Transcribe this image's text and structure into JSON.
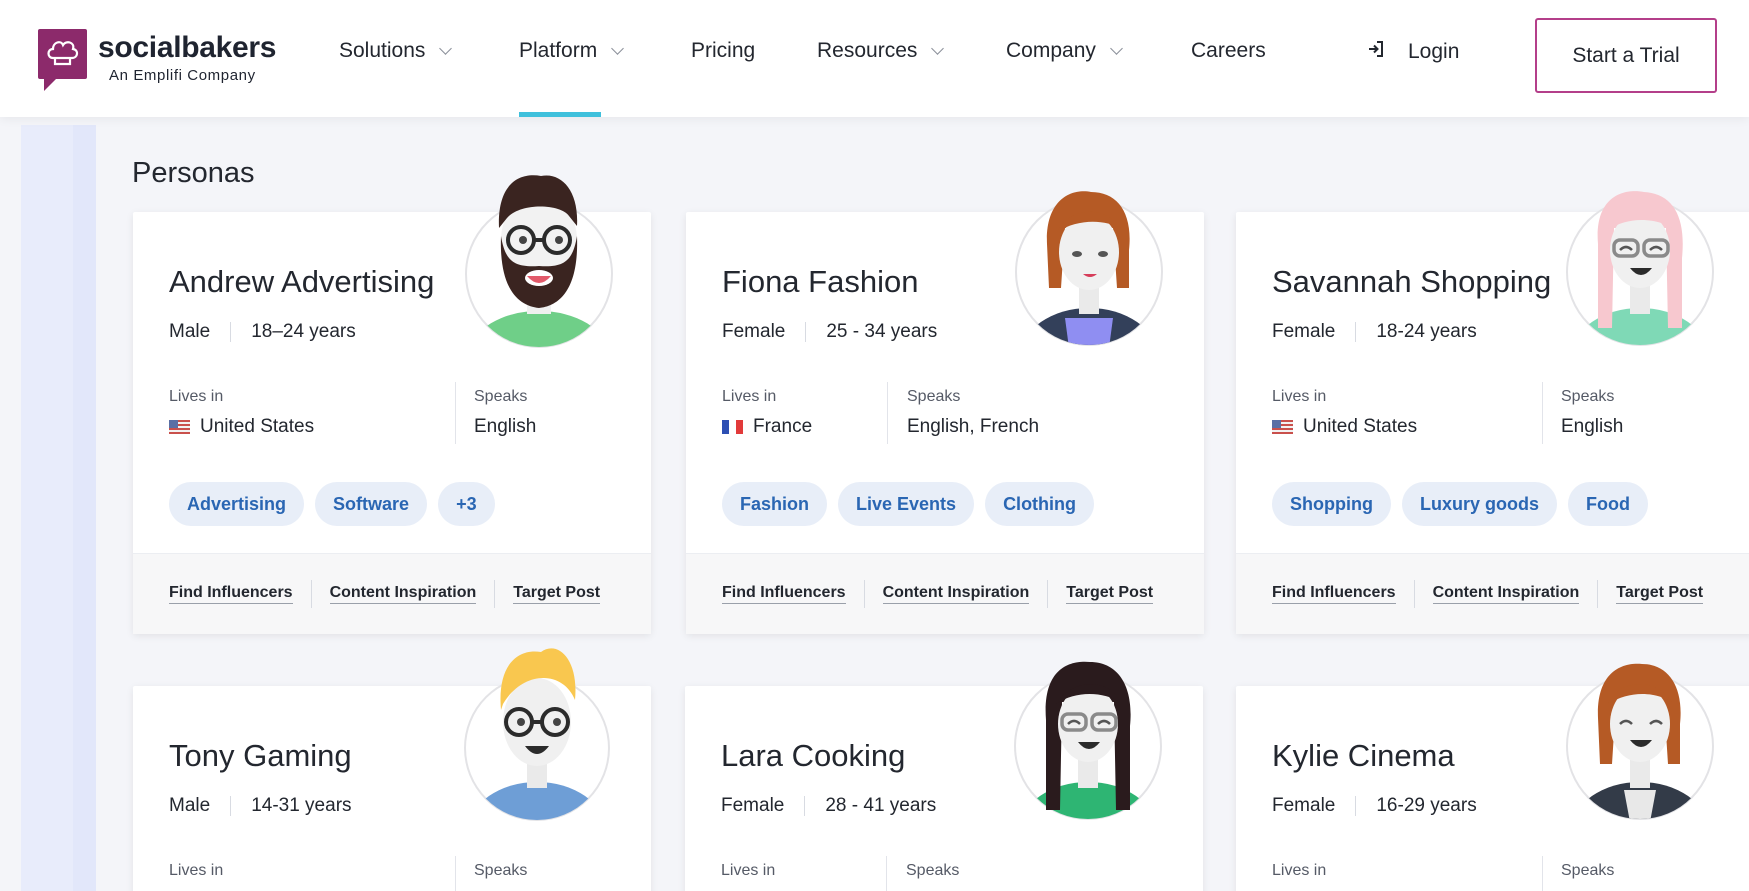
{
  "brand": {
    "name": "socialbakers",
    "subtitle": "An Emplifi Company",
    "color": "#8c2a6b"
  },
  "nav": {
    "solutions": "Solutions",
    "platform": "Platform",
    "pricing": "Pricing",
    "resources": "Resources",
    "company": "Company",
    "careers": "Careers",
    "login": "Login",
    "trial": "Start a Trial",
    "active": "Platform",
    "accent": "#3fc0dc"
  },
  "section_title": "Personas",
  "personas": [
    {
      "name": "Andrew Advertising",
      "gender": "Male",
      "age": "18–24 years",
      "lives_label": "Lives in",
      "lives": "United States",
      "flag": "us",
      "speaks_label": "Speaks",
      "speaks": "English",
      "tags": [
        "Advertising",
        "Software",
        "+3"
      ],
      "links": [
        "Find Influencers",
        "Content Inspiration",
        "Target Post"
      ]
    },
    {
      "name": "Fiona Fashion",
      "gender": "Female",
      "age": "25 - 34 years",
      "lives_label": "Lives in",
      "lives": "France",
      "flag": "fr",
      "speaks_label": "Speaks",
      "speaks": "English, French",
      "tags": [
        "Fashion",
        "Live Events",
        "Clothing"
      ],
      "links": [
        "Find Influencers",
        "Content Inspiration",
        "Target Post"
      ]
    },
    {
      "name": "Savannah Shopping",
      "gender": "Female",
      "age": "18-24 years",
      "lives_label": "Lives in",
      "lives": "United States",
      "flag": "us",
      "speaks_label": "Speaks",
      "speaks": "English",
      "tags": [
        "Shopping",
        "Luxury goods",
        "Food"
      ],
      "links": [
        "Find Influencers",
        "Content Inspiration",
        "Target Post"
      ]
    },
    {
      "name": "Tony Gaming",
      "gender": "Male",
      "age": "14-31 years",
      "lives_label": "Lives in",
      "speaks_label": "Speaks"
    },
    {
      "name": "Lara Cooking",
      "gender": "Female",
      "age": "28 - 41 years",
      "lives_label": "Lives in",
      "speaks_label": "Speaks"
    },
    {
      "name": "Kylie Cinema",
      "gender": "Female",
      "age": "16-29 years",
      "lives_label": "Lives in",
      "speaks_label": "Speaks"
    }
  ]
}
